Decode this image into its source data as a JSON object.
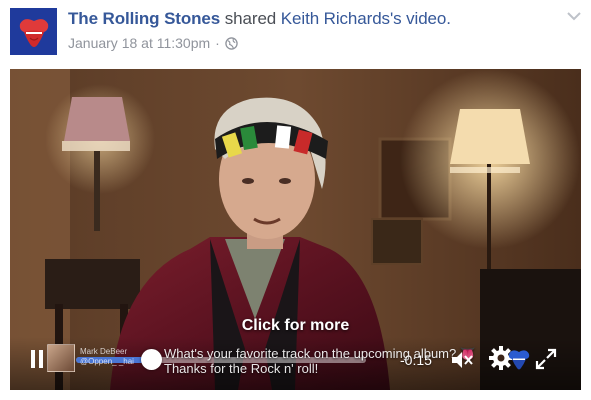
{
  "post": {
    "page_name": "The Rolling Stones",
    "shared_text": " shared ",
    "owner_name": "Keith Richards",
    "owner_suffix": "'s video.",
    "timestamp": "January 18 at 11:30pm",
    "separator": "·",
    "privacy_icon": "globe-icon",
    "menu_icon": "chevron-down-icon",
    "avatar_icon": "tongue-logo-icon",
    "brand_color": "#365899"
  },
  "video": {
    "overlay_text": "Click for more",
    "comment_author": "Mark DeBeer",
    "comment_handle": "@Oppen_ _hai",
    "comment_line1": "What's your favorite track on the upcoming album? 👅",
    "comment_line2": "Thanks for the Rock n' roll!",
    "time_remaining": "-0:15",
    "progress": 0.26,
    "progress_color": "#4a76d4",
    "icons": [
      "pause-icon",
      "mute-icon",
      "settings-icon",
      "tongue-logo-icon",
      "fullscreen-icon"
    ]
  }
}
